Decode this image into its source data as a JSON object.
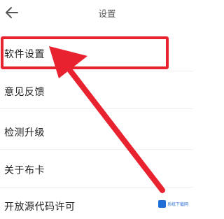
{
  "header": {
    "back_icon": "arrow-left-icon",
    "title": "设置"
  },
  "settings": {
    "items": [
      {
        "label": "软件设置"
      },
      {
        "label": "意见反馈"
      },
      {
        "label": "检测升级"
      },
      {
        "label": "关于布卡"
      },
      {
        "label": "开放源代码许可"
      }
    ]
  },
  "annotation": {
    "highlight_color": "#e8232f",
    "pointer_icon": "red-arrow-icon"
  },
  "watermark": {
    "logo_icon": "site-logo-icon",
    "text": "系统下载网"
  }
}
